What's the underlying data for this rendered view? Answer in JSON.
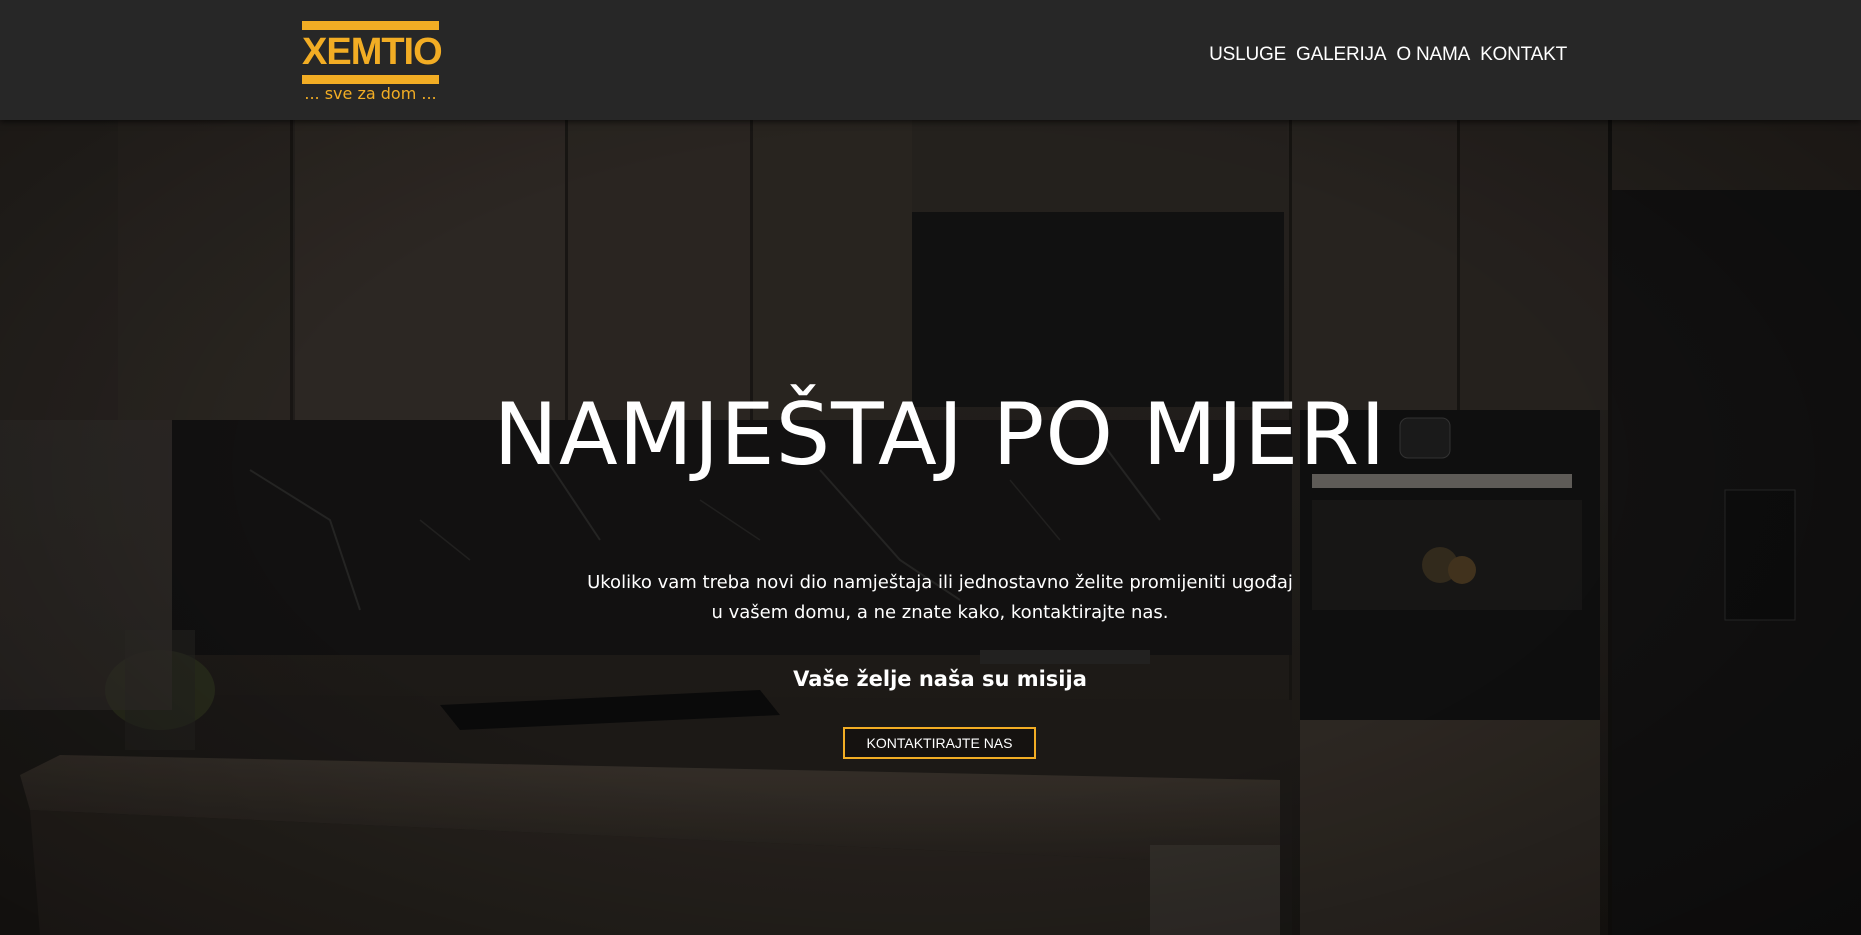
{
  "header": {
    "logo": {
      "name": "XEMTIO",
      "tagline": "... sve za dom ..."
    },
    "nav": [
      {
        "label": "USLUGE"
      },
      {
        "label": "GALERIJA"
      },
      {
        "label": "O NAMA"
      },
      {
        "label": "KONTAKT"
      }
    ]
  },
  "hero": {
    "title": "NAMJEŠTAJ PO MJERI",
    "description": "Ukoliko vam treba novi dio namještaja ili jednostavno želite promijeniti ugođaj u vašem domu, a ne znate kako, kontaktirajte nas.",
    "motto": "Vaše želje naša su misija",
    "cta_label": "KONTAKTIRAJTE NAS"
  },
  "colors": {
    "accent": "#f2ad24",
    "header_bg": "#272727",
    "text": "#ffffff"
  }
}
